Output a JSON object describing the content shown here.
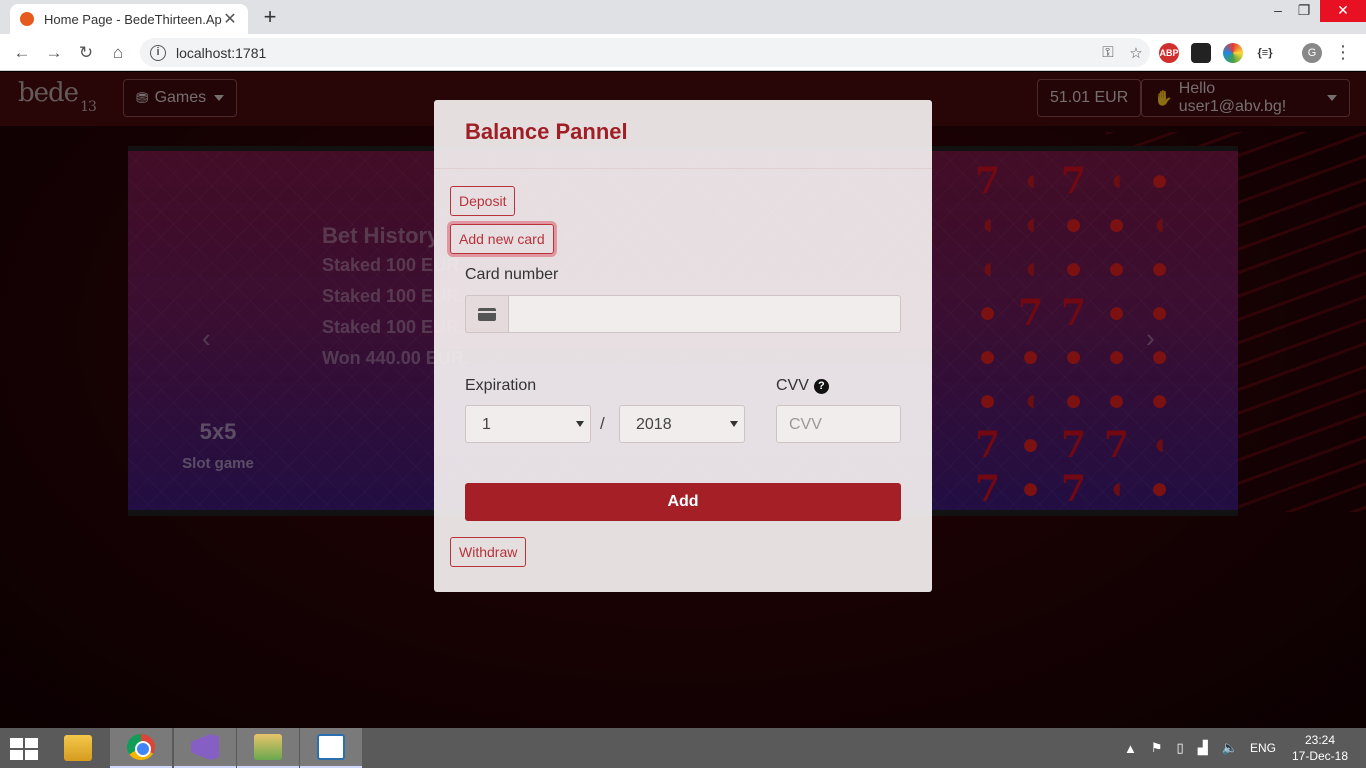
{
  "browser": {
    "tab_title": "Home Page - BedeThirteen.App",
    "tab_close": "✕",
    "new_tab": "+",
    "window_controls": {
      "minimize": "–",
      "maximize": "❐",
      "close": "✕"
    },
    "nav": {
      "back": "←",
      "forward": "→",
      "reload": "↻",
      "home": "⌂"
    },
    "url": "localhost:1781",
    "info_icon": "i",
    "key_icon": "⚿",
    "star_icon": "☆",
    "extensions": {
      "abp": "ABP",
      "e4": "{≡}"
    },
    "profile_initial": "G",
    "menu_icon": "⋮"
  },
  "site": {
    "logo": "bede",
    "logo_sub": "13",
    "games_icon": "⛃",
    "games_label": "Games",
    "balance": "51.01 EUR",
    "user_icon": "✋",
    "user_greeting": "Hello user1@abv.bg!"
  },
  "carousel": {
    "prev_icon": "‹",
    "next_icon": "›",
    "history_title": "Bet History",
    "history_lines": [
      "Staked 100 EUR.",
      "Staked 100 EUR.",
      "Staked 100 EUR.",
      "Won 440.00 EUR."
    ],
    "game_name": "5x5",
    "game_sub": "Slot game",
    "slot_symbols": [
      [
        "seven",
        "melon",
        "seven",
        "melon",
        "cherry"
      ],
      [
        "melon",
        "melon",
        "cherry",
        "cherry",
        "melon"
      ],
      [
        "melon",
        "melon",
        "cherry",
        "cherry",
        "cherry"
      ],
      [
        "cherry",
        "seven",
        "seven",
        "cherry",
        "cherry"
      ],
      [
        "cherry",
        "cherry",
        "cherry",
        "cherry",
        "cherry"
      ],
      [
        "cherry",
        "melon",
        "cherry",
        "cherry",
        "cherry"
      ],
      [
        "seven",
        "cherry",
        "seven",
        "seven",
        "melon"
      ],
      [
        "seven",
        "cherry",
        "seven",
        "melon",
        "cherry"
      ]
    ]
  },
  "modal": {
    "title": "Balance Pannel",
    "deposit": "Deposit",
    "add_new_card": "Add new card",
    "card_number_label": "Card number",
    "card_number_value": "",
    "expiration_label": "Expiration",
    "month_selected": "1",
    "separator": "/",
    "year_selected": "2018",
    "cvv_label": "CVV",
    "cvv_help": "?",
    "cvv_placeholder": "CVV",
    "add_button": "Add",
    "withdraw": "Withdraw"
  },
  "taskbar": {
    "tray_icons": [
      "▲",
      "⚑",
      "▯",
      "▟",
      "🔈"
    ],
    "language": "ENG",
    "time": "23:24",
    "date": "17-Dec-18"
  },
  "colors": {
    "accent": "#a51f27",
    "outline": "#b8323a",
    "navbar": "#4a0c10"
  }
}
